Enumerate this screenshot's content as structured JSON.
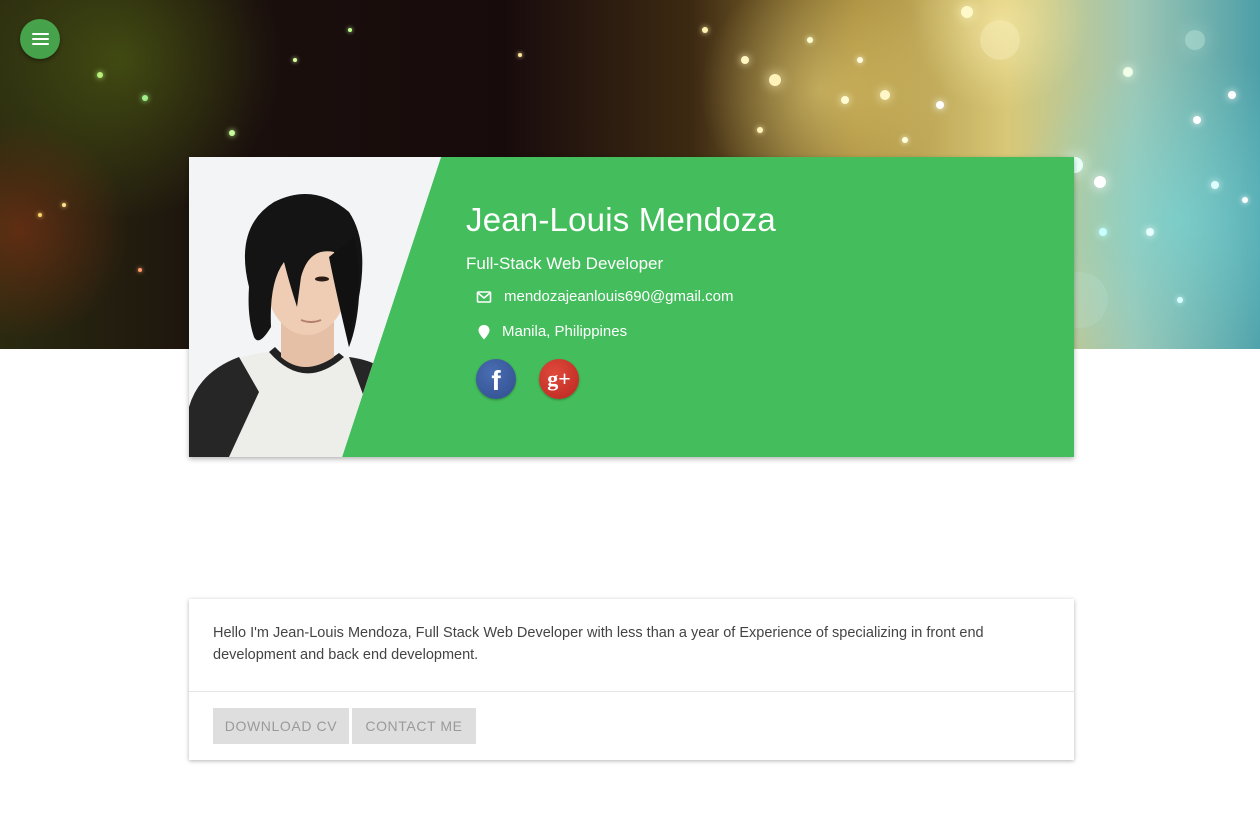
{
  "nav": {
    "menu_icon": "hamburger-menu-icon"
  },
  "profile": {
    "name": "Jean-Louis Mendoza",
    "title": "Full-Stack Web Developer",
    "email": "mendozajeanlouis690@gmail.com",
    "location": "Manila, Philippines",
    "accent_color": "#44bd5c",
    "social": [
      {
        "network": "facebook",
        "glyph": "f",
        "icon": "facebook-icon"
      },
      {
        "network": "google-plus",
        "glyph": "g+",
        "icon": "google-plus-icon"
      }
    ]
  },
  "about": {
    "text": "Hello I'm Jean-Louis Mendoza, Full Stack Web Developer with less than a year of Experience of specializing in front end development and back end development.",
    "download_label": "DOWNLOAD CV",
    "contact_label": "CONTACT ME"
  }
}
